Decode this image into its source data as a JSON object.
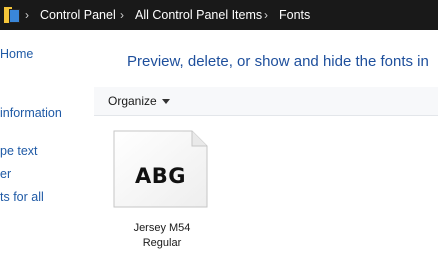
{
  "breadcrumb": {
    "items": [
      "Control Panel",
      "All Control Panel Items",
      "Fonts"
    ],
    "separator": "›"
  },
  "nav": {
    "items": [
      "Home",
      "information",
      "pe text",
      "er",
      "ts for all"
    ]
  },
  "main": {
    "heading": "Preview, delete, or show and hide the fonts in",
    "toolbar": {
      "organize_label": "Organize"
    },
    "fonts": [
      {
        "preview": "ABG",
        "name_line1": "Jersey M54",
        "name_line2": "Regular"
      }
    ]
  },
  "colors": {
    "addressbar_bg": "#191919",
    "link": "#1f5aa6",
    "heading": "#1e4f9c",
    "toolbar_bg": "#f7f8fa"
  }
}
